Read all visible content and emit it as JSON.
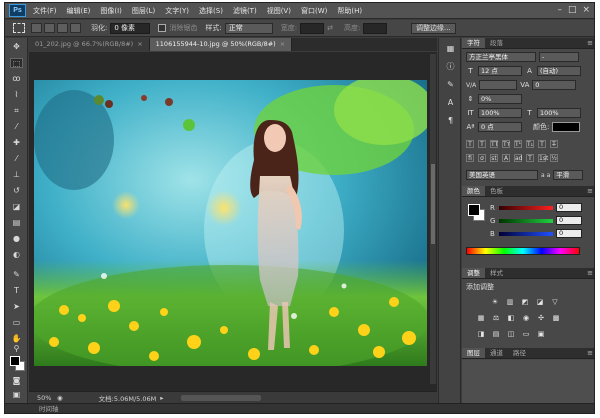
{
  "app": {
    "logo": "Ps"
  },
  "menubar": {
    "items": [
      "文件(F)",
      "编辑(E)",
      "图像(I)",
      "图层(L)",
      "文字(Y)",
      "选择(S)",
      "滤镜(T)",
      "视图(V)",
      "窗口(W)",
      "帮助(H)"
    ]
  },
  "window_controls": {
    "minimize": "–",
    "restore": "□",
    "close": "×"
  },
  "options": {
    "feather_label": "羽化:",
    "feather_value": "0 像素",
    "antialias_label": "消除锯齿",
    "style_label": "样式:",
    "style_value": "正常",
    "width_label": "宽度:",
    "height_label": "高度:",
    "refine_edge": "调整边缘..."
  },
  "documents": {
    "tabs": [
      {
        "label": "01_202.jpg @ 66.7%(RGB/8#)",
        "active": false
      },
      {
        "label": "1106155944-10.jpg @ 50%(RGB/8#)",
        "active": true
      }
    ],
    "close_glyph": "×"
  },
  "status": {
    "zoom": "50%",
    "doc_info": "文档:5.06M/5.06M"
  },
  "timeline": {
    "label": "时间轴"
  },
  "character_panel": {
    "tabs": [
      "字符",
      "段落"
    ],
    "font_family": "方正兰亭黑体",
    "font_style": "-",
    "font_size": "12 点",
    "leading": "(自动)",
    "kerning": "V/A",
    "tracking": "0",
    "vertical_scale_pct": "0%",
    "vscale": "100%",
    "hscale": "100%",
    "baseline": "0 点",
    "color_label": "颜色:",
    "format_buttons": [
      "T",
      "T",
      "TT",
      "Tт",
      "T¹",
      "T₁",
      "T",
      "T̶"
    ],
    "extra_buttons": [
      "fi",
      "σ",
      "st",
      "A",
      "ad",
      "T",
      "1st",
      "½"
    ],
    "language": "美国英语",
    "antialias_mode": "平滑",
    "aa_prefix": "a a"
  },
  "color_panel": {
    "tabs": [
      "颜色",
      "色板"
    ],
    "channels": [
      {
        "label": "R",
        "value": "0",
        "color": "#d02020"
      },
      {
        "label": "G",
        "value": "0",
        "color": "#20a030"
      },
      {
        "label": "B",
        "value": "0",
        "color": "#2040d0"
      }
    ]
  },
  "adjustments_panel": {
    "tabs": [
      "调整",
      "样式"
    ],
    "title": "添加调整"
  },
  "layers_panel": {
    "tabs": [
      "图层",
      "通道",
      "路径"
    ]
  },
  "tools": [
    "move",
    "marquee",
    "lasso",
    "quick-select",
    "crop",
    "eyedropper",
    "healing",
    "brush",
    "clone",
    "history-brush",
    "eraser",
    "gradient",
    "blur",
    "dodge",
    "pen",
    "type",
    "path-select",
    "shape",
    "hand",
    "zoom"
  ]
}
